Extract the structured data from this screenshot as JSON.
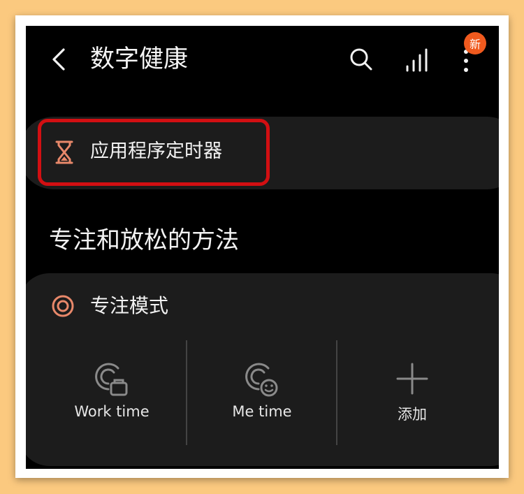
{
  "header": {
    "title": "数字健康",
    "back_icon": "chevron-left-icon",
    "search_icon": "search-icon",
    "stats_icon": "bar-chart-icon",
    "more_icon": "more-vertical-icon",
    "badge": "新",
    "badge_color": "#f05a1e"
  },
  "app_timer": {
    "icon": "hourglass-icon",
    "label": "应用程序定时器",
    "highlight_color": "#d20f12",
    "icon_color": "#e8886a"
  },
  "section": {
    "heading": "专注和放松的方法"
  },
  "focus_mode": {
    "icon": "target-icon",
    "title": "专注模式",
    "modes": [
      {
        "label": "Work time",
        "icon": "work-time-icon"
      },
      {
        "label": "Me time",
        "icon": "me-time-icon"
      },
      {
        "label": "添加",
        "icon": "plus-icon"
      }
    ]
  }
}
